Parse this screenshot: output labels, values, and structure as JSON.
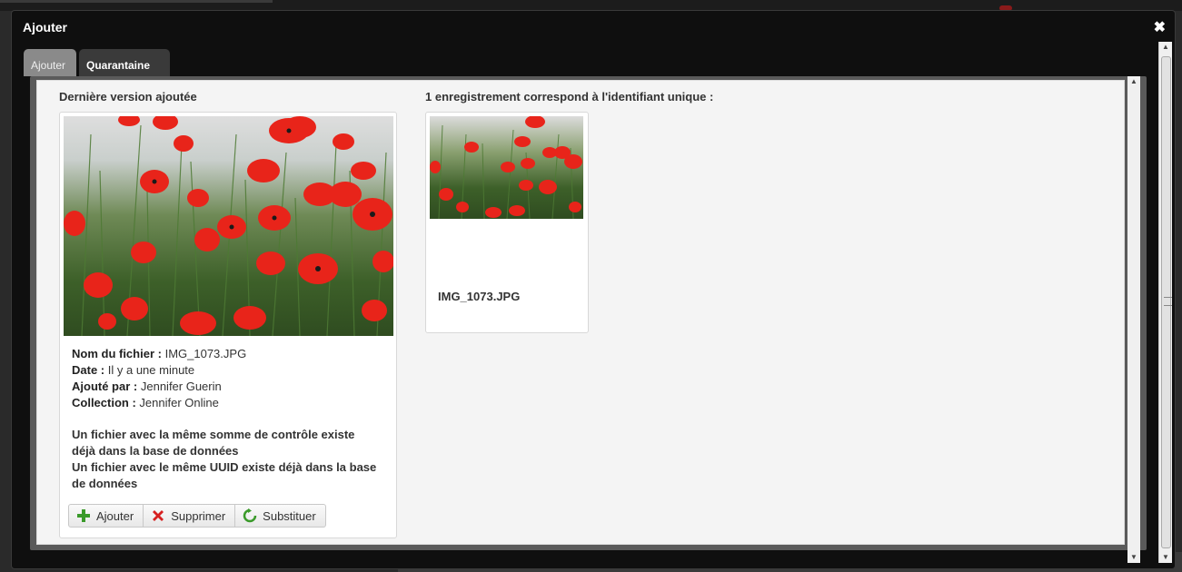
{
  "dialog": {
    "title": "Ajouter",
    "close_icon": "close-icon"
  },
  "tabs": [
    {
      "label": "Ajouter",
      "active": false
    },
    {
      "label": "Quarantaine",
      "active": true
    }
  ],
  "left": {
    "title": "Dernière version ajoutée",
    "meta": {
      "filename_label": "Nom du fichier :",
      "filename": "IMG_1073.JPG",
      "date_label": "Date :",
      "date": "Il y a une minute",
      "added_by_label": "Ajouté par :",
      "added_by": "Jennifer Guerin",
      "collection_label": "Collection :",
      "collection": "Jennifer Online"
    },
    "warnings": [
      "Un fichier avec la même somme de contrôle existe déjà dans la base de données",
      "Un fichier avec le même UUID existe déjà dans la base de données"
    ],
    "actions": {
      "add": {
        "label": "Ajouter",
        "icon": "plus-icon"
      },
      "delete": {
        "label": "Supprimer",
        "icon": "red-x-icon"
      },
      "replace": {
        "label": "Substituer",
        "icon": "refresh-icon"
      }
    }
  },
  "right": {
    "title": "1 enregistrement correspond à l'identifiant unique :",
    "records": [
      {
        "filename": "IMG_1073.JPG"
      }
    ]
  },
  "colors": {
    "dialog_bg": "#0f0f0f",
    "content_bg": "#f4f4f4",
    "poppy_red": "#e8241a",
    "add_green": "#3a9a2a",
    "delete_red": "#d62020"
  }
}
